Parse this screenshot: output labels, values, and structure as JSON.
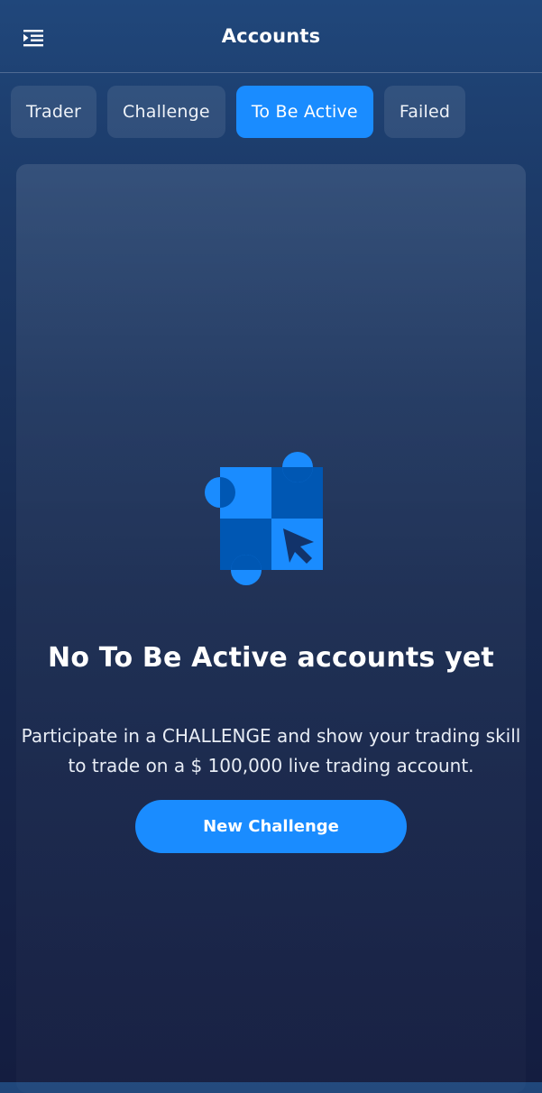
{
  "header": {
    "title": "Accounts",
    "menu_icon": "menu-indent-icon"
  },
  "tabs": [
    {
      "label": "Trader",
      "active": false
    },
    {
      "label": "Challenge",
      "active": false
    },
    {
      "label": "To Be Active",
      "active": true
    },
    {
      "label": "Failed",
      "active": false
    }
  ],
  "empty_state": {
    "illustration_icon": "checkerboard-cursor-icon",
    "title": "No To Be Active accounts yet",
    "description": "Participate in a CHALLENGE and show your trading skill to trade on a $ 100,000 live trading account.",
    "button_label": "New Challenge"
  },
  "colors": {
    "accent": "#1a8cff",
    "accent_dark": "#0057b3",
    "background_top": "#20477b",
    "background_bottom": "#141d40"
  }
}
